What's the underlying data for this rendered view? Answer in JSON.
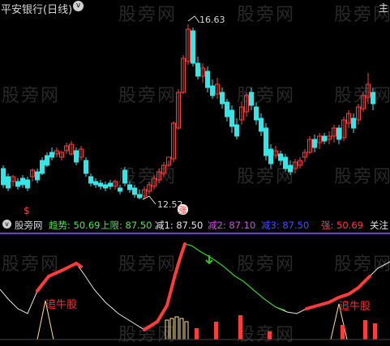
{
  "main_panel": {
    "title": "平安银行(日线)",
    "chevron": "v",
    "corner_label": "主",
    "high_label": "16.63",
    "low_label": "12.52",
    "marker_dollar": "$",
    "marker_zhang": "涨"
  },
  "indicator_bar": {
    "chevron": "v",
    "name": "股旁网",
    "trend": "趋势: 50.69",
    "upper": "上限: 87.50",
    "j1": "减1: 87.50",
    "j2": "减2: 87.10",
    "j3": "减3: 87.50",
    "strong": "强: 50.69",
    "follow": "关注"
  },
  "signals": {
    "chase1": "追牛股",
    "chase2": "追牛股"
  },
  "watermark": "股旁网",
  "colors": {
    "up": "#ff3b3b",
    "down": "#35e6e6",
    "trend_green": "#31c41c",
    "white_line": "#e6e6e6",
    "purple": "#6a3fd0",
    "yellow": "#ffe28a"
  }
}
